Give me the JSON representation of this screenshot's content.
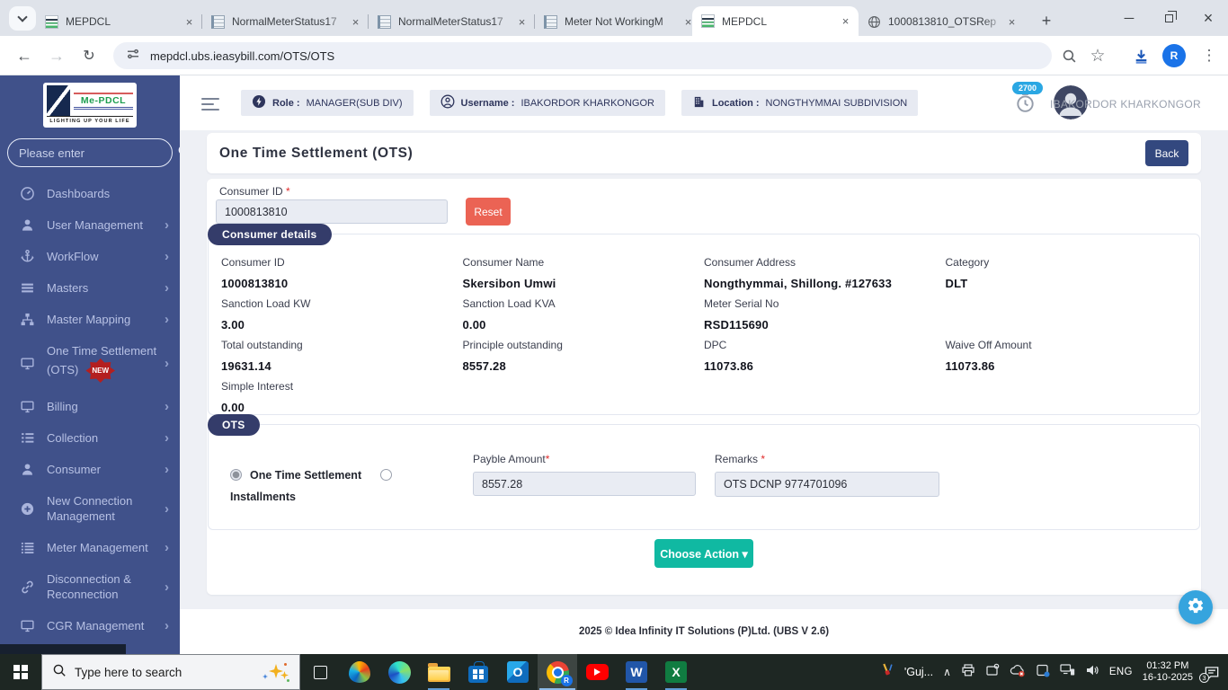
{
  "browser": {
    "tabs": [
      {
        "label": "MEPDCL"
      },
      {
        "label": "NormalMeterStatus17"
      },
      {
        "label": "NormalMeterStatus17"
      },
      {
        "label": "Meter Not WorkingM"
      },
      {
        "label": "MEPDCL"
      },
      {
        "label": "1000813810_OTSRep"
      }
    ],
    "url": "mepdcl.ubs.ieasybill.com/OTS/OTS",
    "profile_initial": "R"
  },
  "icons": {
    "back": "←",
    "forward": "→",
    "reload": "↻",
    "star": "☆",
    "kebab": "⋮",
    "minimize": "─",
    "close": "×",
    "new_tab": "+",
    "tab_close": "×",
    "chevron_right": "›",
    "caret_down": "▾",
    "tray_chevron": "∧"
  },
  "sidebar": {
    "logo_text": "Me-PDCL",
    "logo_tagline": "LIGHTING UP YOUR LIFE",
    "search_placeholder": "Please enter",
    "new_badge": "NEW",
    "items": [
      {
        "label": "Dashboards"
      },
      {
        "label": "User Management"
      },
      {
        "label": "WorkFlow"
      },
      {
        "label": "Masters"
      },
      {
        "label": "Master Mapping"
      },
      {
        "label": "One Time Settlement (OTS)"
      },
      {
        "label": "Billing"
      },
      {
        "label": "Collection"
      },
      {
        "label": "Consumer"
      },
      {
        "label": "New Connection Management"
      },
      {
        "label": "Meter Management"
      },
      {
        "label": "Disconnection & Reconnection"
      },
      {
        "label": "CGR Management"
      }
    ]
  },
  "header": {
    "role_label": "Role :",
    "role_value": "MANAGER(SUB DIV)",
    "username_label": "Username :",
    "username_value": "IBAKORDOR KHARKONGOR",
    "location_label": "Location :",
    "location_value": "NONGTHYMMAI SUBDIVISION",
    "points": "2700",
    "user_display_name": "IBAKORDOR KHARKONGOR"
  },
  "page": {
    "title": "One Time Settlement (OTS)",
    "back_label": "Back",
    "consumer_id_label": "Consumer ID",
    "consumer_id_value": "1000813810",
    "reset_label": "Reset",
    "required_mark": "*"
  },
  "consumer_details": {
    "badge": "Consumer details",
    "rows": [
      [
        {
          "label": "Consumer ID",
          "value": "1000813810"
        },
        {
          "label": "Consumer Name",
          "value": "Skersibon Umwi"
        },
        {
          "label": "Consumer Address",
          "value": "Nongthymmai, Shillong. #127633"
        },
        {
          "label": "Category",
          "value": "DLT"
        }
      ],
      [
        {
          "label": "Sanction Load KW",
          "value": "3.00"
        },
        {
          "label": "Sanction Load KVA",
          "value": "0.00"
        },
        {
          "label": "Meter Serial No",
          "value": "RSD115690"
        },
        {
          "label": "",
          "value": ""
        }
      ],
      [
        {
          "label": "Total outstanding",
          "value": "19631.14"
        },
        {
          "label": "Principle outstanding",
          "value": "8557.28"
        },
        {
          "label": "DPC",
          "value": "11073.86"
        },
        {
          "label": "Waive Off Amount",
          "value": "11073.86"
        }
      ],
      [
        {
          "label": "Simple Interest",
          "value": "0.00"
        },
        {
          "label": "",
          "value": ""
        },
        {
          "label": "",
          "value": ""
        },
        {
          "label": "",
          "value": ""
        }
      ]
    ]
  },
  "ots": {
    "badge": "OTS",
    "option1": "One Time Settlement",
    "option2": "Installments",
    "payable_label": "Payble Amount",
    "payable_value": "8557.28",
    "remarks_label": "Remarks",
    "remarks_value": "OTS DCNP 9774701096",
    "action_label": "Choose Action"
  },
  "footer": {
    "text": "2025 © Idea Infinity IT Solutions (P)Ltd. (UBS V 2.6)"
  },
  "taskbar": {
    "search_placeholder": "Type here to search",
    "lang_text": "'Guj...",
    "lang_code": "ENG",
    "time": "01:32 PM",
    "date": "16-10-2025",
    "notification_count": "3"
  }
}
